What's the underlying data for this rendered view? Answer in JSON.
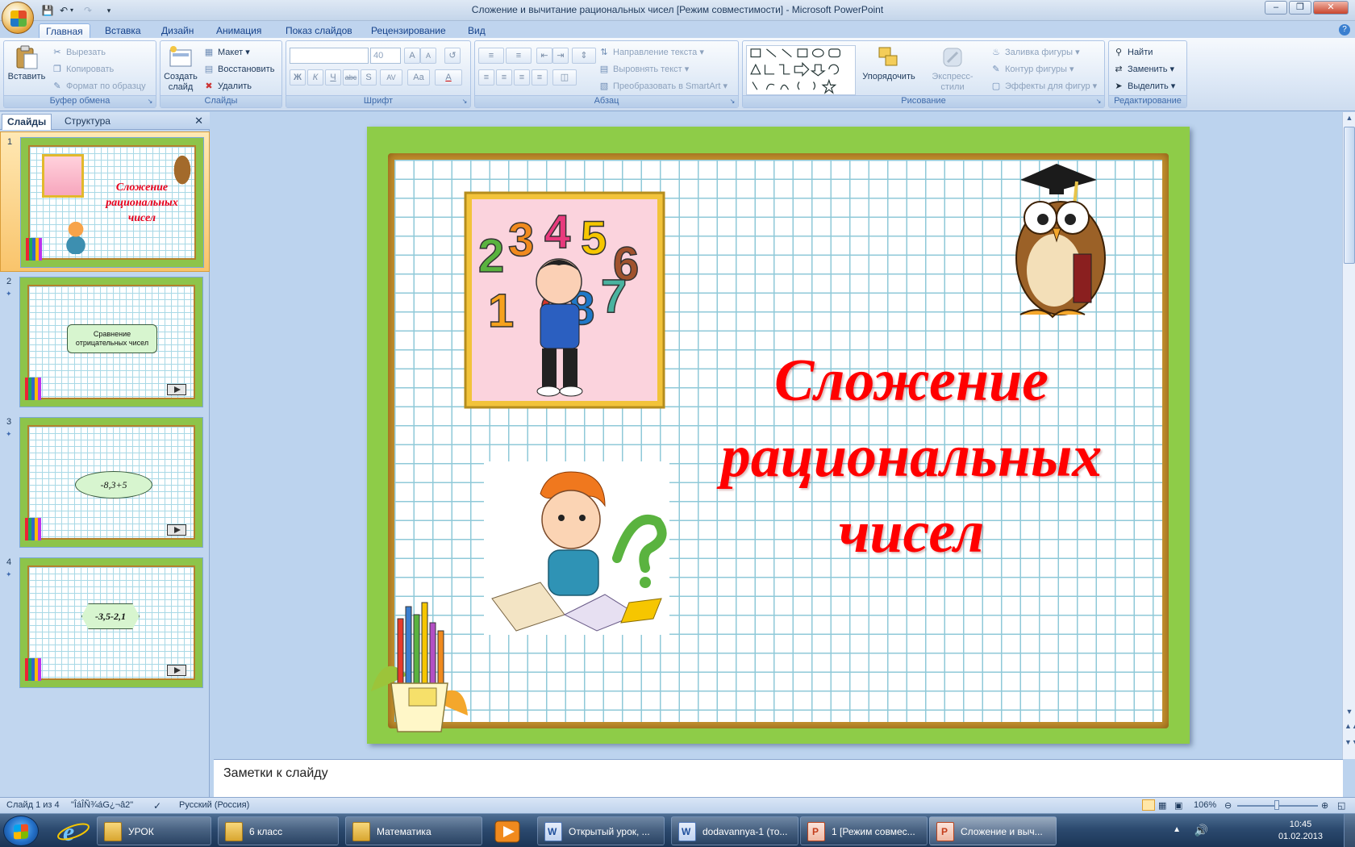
{
  "window": {
    "title": "Сложение и вычитание рациональных чисел [Режим совместимости] - Microsoft PowerPoint",
    "minimize_icon": "minimize-icon",
    "maximize_icon": "restore-icon",
    "close_icon": "close-icon"
  },
  "ribbon_tabs": [
    "Главная",
    "Вставка",
    "Дизайн",
    "Анимация",
    "Показ слайдов",
    "Рецензирование",
    "Вид"
  ],
  "clipboard": {
    "paste": "Вставить",
    "cut": "Вырезать",
    "copy": "Копировать",
    "format_painter": "Формат по образцу",
    "label": "Буфер обмена"
  },
  "slides_group": {
    "new_slide_line1": "Создать",
    "new_slide_line2": "слайд",
    "layout": "Макет",
    "reset": "Восстановить",
    "delete": "Удалить",
    "label": "Слайды"
  },
  "font_group": {
    "font_name": "",
    "font_size": "40",
    "label": "Шрифт",
    "bold": "Ж",
    "italic": "К",
    "underline": "Ч",
    "strike": "abc",
    "shadow": "S",
    "spacing": "AV",
    "case": "Aa",
    "color": "A",
    "grow": "A",
    "shrink": "A"
  },
  "paragraph_group": {
    "text_direction": "Направление текста",
    "align_text": "Выровнять текст",
    "smartart": "Преобразовать в SmartArt",
    "label": "Абзац"
  },
  "drawing_group": {
    "arrange": "Упорядочить",
    "quick_styles": "Экспресс-стили",
    "shape_fill": "Заливка фигуры",
    "shape_outline": "Контур фигуры",
    "shape_effects": "Эффекты для фигур",
    "label": "Рисование"
  },
  "editing_group": {
    "find": "Найти",
    "replace": "Заменить",
    "select": "Выделить",
    "label": "Редактирование"
  },
  "left_panel": {
    "tab_slides": "Слайды",
    "tab_outline": "Структура",
    "thumbnails": [
      {
        "num": "1",
        "title_lines": [
          "Сложение",
          "рациональных",
          "чисел"
        ]
      },
      {
        "num": "2",
        "box_text": "Сравнение отрицательных чисел"
      },
      {
        "num": "3",
        "box_text": "-8,3+5"
      },
      {
        "num": "4",
        "box_text": "-3,5-2,1"
      }
    ]
  },
  "slide": {
    "title_lines": [
      "Сложение",
      "рациональных",
      "чисел"
    ],
    "colors": {
      "title": "#ff0000",
      "border": "#8ecc48",
      "frame": "#c5922f",
      "grid": "#8fc9d8"
    }
  },
  "notes": {
    "placeholder": "Заметки к слайду"
  },
  "status": {
    "slide_info": "Слайд 1 из 4",
    "theme": "\"ÎáÎÑ¾áG¿¬â2\"",
    "language": "Русский (Россия)",
    "zoom": "106%"
  },
  "taskbar": {
    "items": [
      {
        "label": "УРОК",
        "icon": "folder-icon"
      },
      {
        "label": "6 класс",
        "icon": "folder-icon"
      },
      {
        "label": "Математика",
        "icon": "folder-icon"
      },
      {
        "label": "Открытый урок, ...",
        "icon": "word-icon"
      },
      {
        "label": "dodavannya-1 (то...",
        "icon": "word-icon"
      },
      {
        "label": "1 [Режим совмес...",
        "icon": "powerpoint-icon"
      },
      {
        "label": "Сложение и выч...",
        "icon": "powerpoint-icon"
      }
    ],
    "time": "10:45",
    "date": "01.02.2013"
  }
}
